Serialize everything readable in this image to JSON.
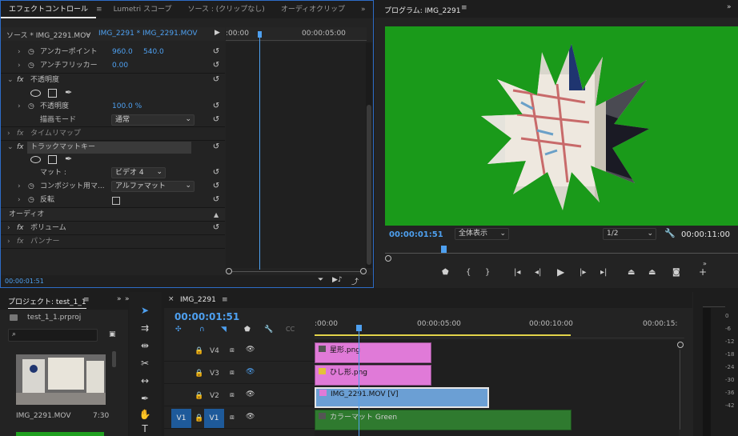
{
  "effect_controls": {
    "tabs": [
      "エフェクトコントロール",
      "≡",
      "Lumetri スコープ",
      "ソース : (クリップなし)",
      "オーディオクリップ",
      "»"
    ],
    "source_label": "ソース * IMG_2291.MOV",
    "clip_label": "IMG_2291 * IMG_2291.MOV",
    "play_arrow": "▶",
    "ruler_start": ":00:00",
    "ruler_mid": "00:00:05:00",
    "anchor": {
      "label": "アンカーポイント",
      "x": "960.0",
      "y": "540.0"
    },
    "antiflicker": {
      "label": "アンチフリッカー",
      "value": "0.00"
    },
    "opacity_group": "不透明度",
    "opacity": {
      "label": "不透明度",
      "value": "100.0 %"
    },
    "blend": {
      "label": "描画モード",
      "value": "通常"
    },
    "time_remap": "タイムリマップ",
    "track_matte": "トラックマットキー",
    "matte": {
      "label": "マット :",
      "value": "ビデオ 4"
    },
    "composite": {
      "label": "コンポジット用マ...",
      "value": "アルファマット"
    },
    "invert": {
      "label": "反転"
    },
    "audio_header": "オーディオ",
    "volume": "ボリューム",
    "panner": "パンナー",
    "fx": "fx",
    "timecode": "00:00:01:51"
  },
  "program": {
    "title": "プログラム: IMG_2291",
    "menu": "≡",
    "more": "»",
    "timecode": "00:00:01:51",
    "fit": "全体表示",
    "resolution": "1/2",
    "duration": "00:00:11:00",
    "bg_color": "#1a9a1a"
  },
  "project": {
    "title": "プロジェクト: test_1_1",
    "menu": "≡",
    "more": "»",
    "file": "test_1_1.prproj",
    "thumb_name": "IMG_2291.MOV",
    "thumb_dur": "7:30"
  },
  "timeline": {
    "tab": "IMG_2291",
    "menu": "≡",
    "close": "×",
    "timecode": "00:00:01:51",
    "ruler": [
      ":00:00",
      "00:00:05:00",
      "00:00:10:00",
      "00:00:15:"
    ],
    "tracks": [
      {
        "name": "V4"
      },
      {
        "name": "V3"
      },
      {
        "name": "V2"
      },
      {
        "name": "V1"
      }
    ],
    "source_patch": "V1",
    "clips": [
      {
        "label": "星形.png",
        "color": "#e07ad8"
      },
      {
        "label": "ひし形.png",
        "color": "#e07ad8"
      },
      {
        "label": "IMG_2291.MOV [V]",
        "color": "#6b9fd4"
      },
      {
        "label": "カラーマット Green",
        "color": "#2f7a2f"
      }
    ]
  },
  "meter": {
    "labels": [
      "0",
      "-6",
      "-12",
      "-18",
      "-24",
      "-30",
      "-36",
      "-42"
    ]
  },
  "icons": {
    "wrench": "wrench-icon",
    "lock": "lock-icon",
    "eye": "eye-icon",
    "play": "play-icon",
    "select": "selection-tool-icon"
  }
}
